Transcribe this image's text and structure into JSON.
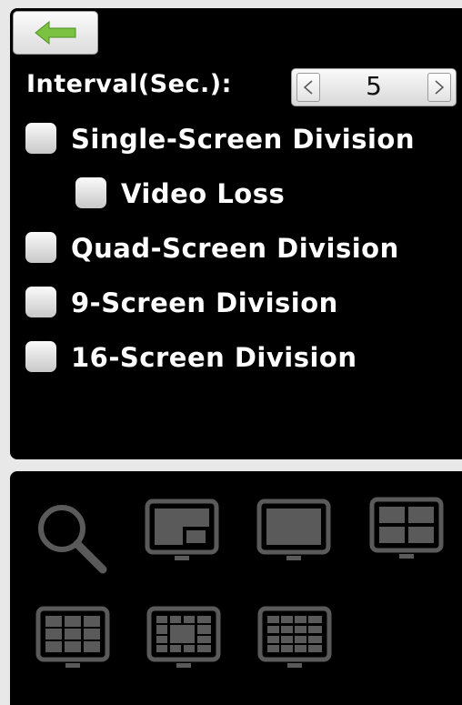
{
  "toolbar": {
    "back_icon": "back-arrow-icon",
    "back_color": "#7cc242"
  },
  "interval": {
    "label": "Interval(Sec.):",
    "value": "5"
  },
  "options": [
    {
      "label": "Single-Screen Division",
      "checked": false
    },
    {
      "label": "Video Loss",
      "checked": false
    },
    {
      "label": "Quad-Screen Division",
      "checked": false
    },
    {
      "label": "9-Screen Division",
      "checked": false
    },
    {
      "label": "16-Screen Division",
      "checked": false
    }
  ],
  "tools": [
    {
      "icon": "search-icon"
    },
    {
      "icon": "picture-in-picture-icon"
    },
    {
      "icon": "single-screen-icon"
    },
    {
      "icon": "quad-screen-icon"
    },
    {
      "icon": "nine-screen-icon"
    },
    {
      "icon": "center-focus-grid-icon"
    },
    {
      "icon": "sixteen-screen-icon"
    }
  ]
}
